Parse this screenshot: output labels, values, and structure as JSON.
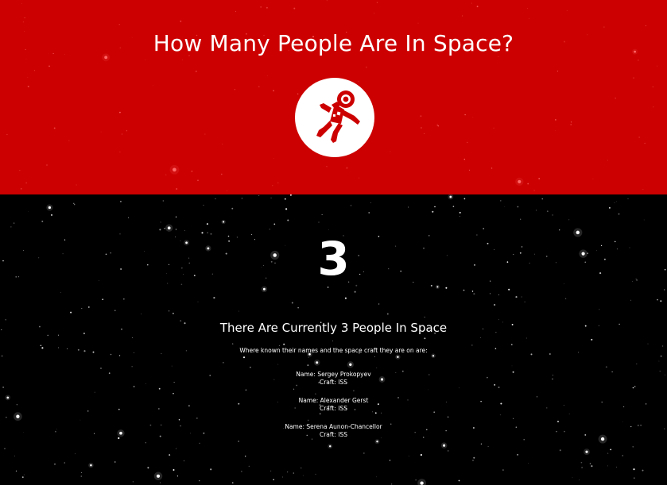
{
  "header": {
    "title": "How Many People Are In Space?",
    "background_color": "#cc0000"
  },
  "logo": {
    "icon": "astronaut-icon",
    "circle_color": "#ffffff",
    "figure_color": "#cc0000"
  },
  "main": {
    "count": "3",
    "subtitle": "There Are Currently 3 People In Space",
    "intro": "Where known their names and the space craft they are on are:",
    "people": [
      {
        "name": "Name: Sergey Prokopyev",
        "craft": "Craft: ISS"
      },
      {
        "name": "Name: Alexander Gerst",
        "craft": "Craft: ISS"
      },
      {
        "name": "Name: Serena Aunon-Chancellor",
        "craft": "Craft: ISS"
      }
    ]
  }
}
